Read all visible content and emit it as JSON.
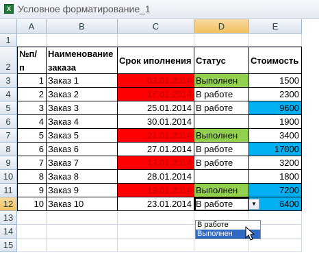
{
  "window": {
    "title": "Условное форматирование_1",
    "app_icon": "excel-icon"
  },
  "columns": [
    "A",
    "B",
    "C",
    "D",
    "E"
  ],
  "rows": [
    "1",
    "2",
    "3",
    "4",
    "5",
    "6",
    "7",
    "8",
    "9",
    "10",
    "11",
    "12",
    "13",
    "14",
    "15"
  ],
  "headers": {
    "a": [
      "№п/",
      "п"
    ],
    "b": [
      "Наименование",
      "заказа"
    ],
    "c": "Срок иполнения",
    "d": "Статус",
    "e": "Стоимость"
  },
  "data": [
    {
      "n": "1",
      "name": "Заказ 1",
      "date": "03.01.2014",
      "status": "Выполнен",
      "cost": "1500",
      "date_hl": true,
      "status_hl": true,
      "cost_hl": false
    },
    {
      "n": "2",
      "name": "Заказ 2",
      "date": "17.01.2014",
      "status": "В работе",
      "cost": "2300",
      "date_hl": true,
      "status_hl": false,
      "cost_hl": false
    },
    {
      "n": "3",
      "name": "Заказ 3",
      "date": "25.01.2014",
      "status": "В работе",
      "cost": "9600",
      "date_hl": false,
      "status_hl": false,
      "cost_hl": true
    },
    {
      "n": "4",
      "name": "Заказ 4",
      "date": "30.01.2014",
      "status": "",
      "cost": "1900",
      "date_hl": false,
      "status_hl": false,
      "cost_hl": false
    },
    {
      "n": "5",
      "name": "Заказ 5",
      "date": "21.01.2014",
      "status": "Выполнен",
      "cost": "3400",
      "date_hl": true,
      "status_hl": true,
      "cost_hl": false
    },
    {
      "n": "6",
      "name": "Заказ 6",
      "date": "27.01.2014",
      "status": "В работе",
      "cost": "17000",
      "date_hl": false,
      "status_hl": false,
      "cost_hl": true
    },
    {
      "n": "7",
      "name": "Заказ 7",
      "date": "13.01.2014",
      "status": "В работе",
      "cost": "3200",
      "date_hl": true,
      "status_hl": false,
      "cost_hl": false
    },
    {
      "n": "8",
      "name": "Заказ 8",
      "date": "28.01.2014",
      "status": "",
      "cost": "1800",
      "date_hl": false,
      "status_hl": false,
      "cost_hl": false
    },
    {
      "n": "9",
      "name": "Заказ 9",
      "date": "19.01.2014",
      "status": "Выполнен",
      "cost": "7200",
      "date_hl": true,
      "status_hl": true,
      "cost_hl": true
    },
    {
      "n": "10",
      "name": "Заказ 10",
      "date": "23.01.2014",
      "status": "В работе",
      "cost": "6400",
      "date_hl": false,
      "status_hl": false,
      "cost_hl": true
    }
  ],
  "dropdown": {
    "options": [
      "В работе",
      "Выполнен"
    ],
    "highlighted": "Выполнен"
  },
  "colors": {
    "overdue": "#ff0000",
    "done": "#92d050",
    "high_cost": "#00b0f0",
    "selection": "#316ac5"
  }
}
